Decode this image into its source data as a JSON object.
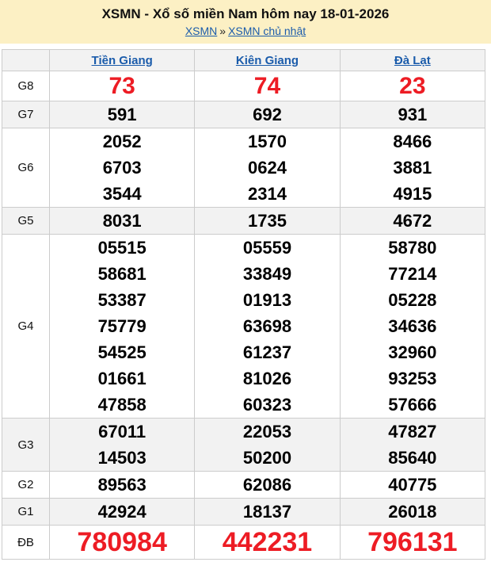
{
  "header": {
    "title": "XSMN - Xổ số miền Nam hôm nay 18-01-2026",
    "breadcrumb": {
      "link1": "XSMN",
      "separator": "»",
      "link2": "XSMN chủ nhật"
    }
  },
  "table": {
    "columns": [
      "Tiền Giang",
      "Kiên Giang",
      "Đà Lạt"
    ],
    "rows": [
      {
        "label": "G8",
        "style": "red-large",
        "cells": [
          [
            "73"
          ],
          [
            "74"
          ],
          [
            "23"
          ]
        ]
      },
      {
        "label": "G7",
        "style": "num-normal",
        "cells": [
          [
            "591"
          ],
          [
            "692"
          ],
          [
            "931"
          ]
        ]
      },
      {
        "label": "G6",
        "style": "num-normal",
        "cells": [
          [
            "2052",
            "6703",
            "3544"
          ],
          [
            "1570",
            "0624",
            "2314"
          ],
          [
            "8466",
            "3881",
            "4915"
          ]
        ]
      },
      {
        "label": "G5",
        "style": "num-normal",
        "cells": [
          [
            "8031"
          ],
          [
            "1735"
          ],
          [
            "4672"
          ]
        ]
      },
      {
        "label": "G4",
        "style": "num-normal",
        "cells": [
          [
            "05515",
            "58681",
            "53387",
            "75779",
            "54525",
            "01661",
            "47858"
          ],
          [
            "05559",
            "33849",
            "01913",
            "63698",
            "61237",
            "81026",
            "60323"
          ],
          [
            "58780",
            "77214",
            "05228",
            "34636",
            "32960",
            "93253",
            "57666"
          ]
        ]
      },
      {
        "label": "G3",
        "style": "num-normal",
        "cells": [
          [
            "67011",
            "14503"
          ],
          [
            "22053",
            "50200"
          ],
          [
            "47827",
            "85640"
          ]
        ]
      },
      {
        "label": "G2",
        "style": "num-normal",
        "cells": [
          [
            "89563"
          ],
          [
            "62086"
          ],
          [
            "40775"
          ]
        ]
      },
      {
        "label": "G1",
        "style": "num-normal",
        "cells": [
          [
            "42924"
          ],
          [
            "18137"
          ],
          [
            "26018"
          ]
        ]
      },
      {
        "label": "ĐB",
        "style": "red-xlarge",
        "cells": [
          [
            "780984"
          ],
          [
            "442231"
          ],
          [
            "796131"
          ]
        ]
      }
    ]
  },
  "colors": {
    "banner_bg": "#fcf0c4",
    "row_shade": "#f2f2f2",
    "border": "#cccccc",
    "link_blue": "#1b5cab",
    "accent_red": "#ed1c24"
  }
}
